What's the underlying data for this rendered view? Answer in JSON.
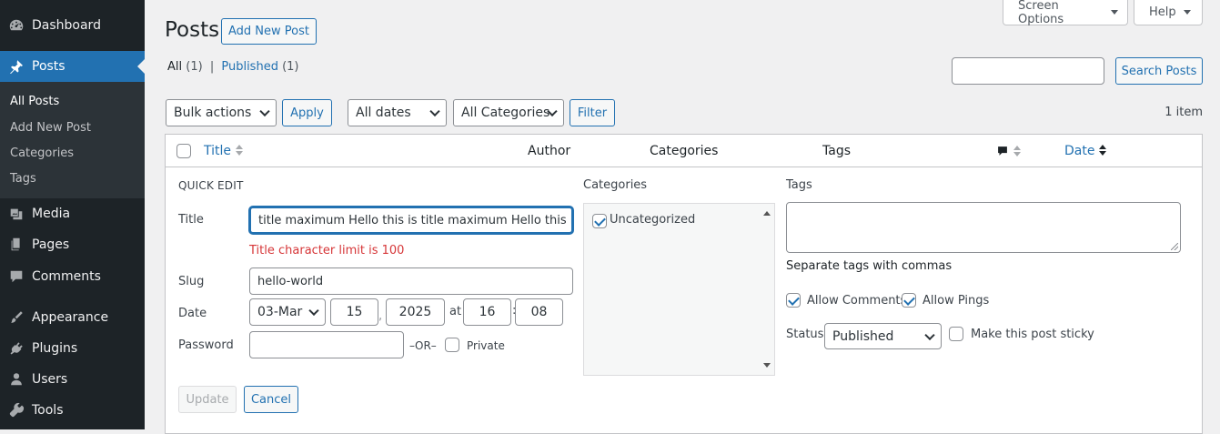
{
  "sidebar": {
    "items": [
      {
        "label": "Dashboard",
        "icon": "dashboard-icon"
      },
      {
        "label": "Posts",
        "icon": "pin-icon",
        "active": true
      },
      {
        "label": "Media",
        "icon": "media-icon"
      },
      {
        "label": "Pages",
        "icon": "pages-icon"
      },
      {
        "label": "Comments",
        "icon": "comment-icon"
      },
      {
        "label": "Appearance",
        "icon": "brush-icon"
      },
      {
        "label": "Plugins",
        "icon": "plugin-icon"
      },
      {
        "label": "Users",
        "icon": "user-icon"
      },
      {
        "label": "Tools",
        "icon": "wrench-icon"
      }
    ],
    "submenu": [
      "All Posts",
      "Add New Post",
      "Categories",
      "Tags"
    ]
  },
  "header": {
    "title": "Posts",
    "add_new_label": "Add New Post",
    "screen_options_label": "Screen Options",
    "help_label": "Help"
  },
  "views": {
    "all_label": "All",
    "all_count": "(1)",
    "separator": "|",
    "published_label": "Published",
    "published_count": "(1)"
  },
  "search": {
    "value": "",
    "button_label": "Search Posts"
  },
  "filters": {
    "bulk_actions": "Bulk actions",
    "apply_label": "Apply",
    "dates": "All dates",
    "categories": "All Categories",
    "filter_label": "Filter",
    "items_count": "1 item"
  },
  "table": {
    "columns": {
      "title": "Title",
      "author": "Author",
      "categories": "Categories",
      "tags": "Tags",
      "comments_icon": "comment-bubble-icon",
      "date": "Date"
    }
  },
  "quick_edit": {
    "heading": "QUICK EDIT",
    "title_label": "Title",
    "title_value_prefix": "title maximum Hello this is title maximum Hello this is ",
    "title_value_misspelled": "ti",
    "title_error": "Title character limit is 100",
    "slug_label": "Slug",
    "slug_value": "hello-world",
    "date_label": "Date",
    "month_value": "03-Mar",
    "day_value": "15",
    "comma": ",",
    "year_value": "2025",
    "at_label": "at",
    "hour_value": "16",
    "colon": ":",
    "minute_value": "08",
    "password_label": "Password",
    "password_value": "",
    "or_label": "–OR–",
    "private_label": "Private",
    "update_label": "Update",
    "cancel_label": "Cancel",
    "categories_heading": "Categories",
    "category_items": [
      {
        "label": "Uncategorized",
        "checked": true
      }
    ],
    "tags_heading": "Tags",
    "tags_value": "",
    "tags_hint": "Separate tags with commas",
    "allow_comments_label": "Allow Comments",
    "allow_comments_checked": true,
    "allow_pings_label": "Allow Pings",
    "allow_pings_checked": true,
    "status_label": "Status",
    "status_value": "Published",
    "sticky_label": "Make this post sticky",
    "sticky_checked": false
  },
  "colors": {
    "accent": "#2271b1",
    "sidebar_bg": "#1d2327",
    "error": "#d63638"
  }
}
